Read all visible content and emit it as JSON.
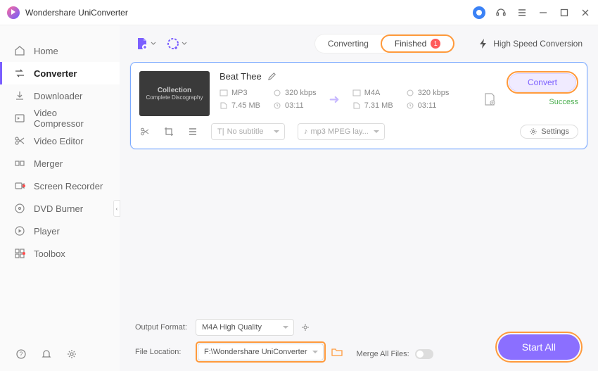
{
  "app_title": "Wondershare UniConverter",
  "sidebar": {
    "items": [
      {
        "label": "Home",
        "active": false
      },
      {
        "label": "Converter",
        "active": true
      },
      {
        "label": "Downloader",
        "active": false
      },
      {
        "label": "Video Compressor",
        "active": false
      },
      {
        "label": "Video Editor",
        "active": false
      },
      {
        "label": "Merger",
        "active": false
      },
      {
        "label": "Screen Recorder",
        "active": false,
        "dot": true
      },
      {
        "label": "DVD Burner",
        "active": false
      },
      {
        "label": "Player",
        "active": false
      },
      {
        "label": "Toolbox",
        "active": false,
        "dot": true
      }
    ]
  },
  "tabs": {
    "converting": "Converting",
    "finished": "Finished",
    "finished_count": "1"
  },
  "speed_label": "High Speed Conversion",
  "item": {
    "title": "Beat Thee",
    "thumb_line1": "Collection",
    "thumb_line2": "Complete Discography",
    "src": {
      "format": "MP3",
      "bitrate": "320 kbps",
      "size": "7.45 MB",
      "duration": "03:11"
    },
    "dst": {
      "format": "M4A",
      "bitrate": "320 kbps",
      "size": "7.31 MB",
      "duration": "03:11"
    },
    "subtitle": "No subtitle",
    "audio_layer": "mp3 MPEG lay...",
    "settings": "Settings",
    "convert": "Convert",
    "status": "Success"
  },
  "footer": {
    "output_format_label": "Output Format:",
    "output_format": "M4A High Quality",
    "file_location_label": "File Location:",
    "file_location": "F:\\Wondershare UniConverter",
    "merge_label": "Merge All Files:",
    "start": "Start All"
  }
}
